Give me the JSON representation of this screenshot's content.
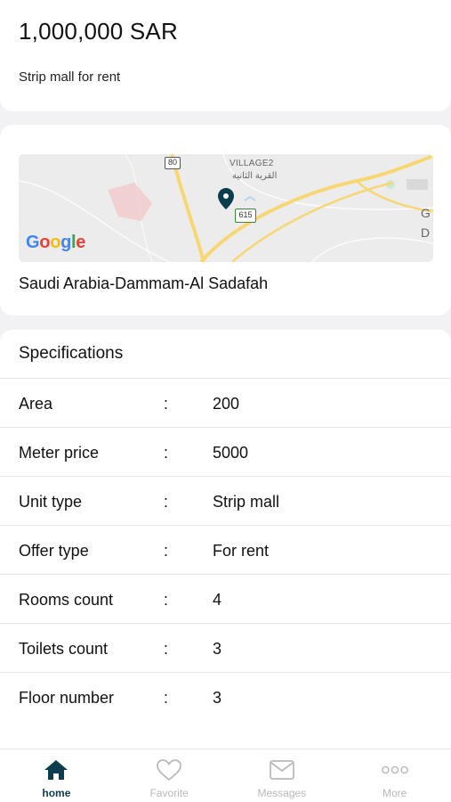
{
  "listing": {
    "price": "1,000,000 SAR",
    "subtitle": "Strip mall for rent",
    "address": "Saudi Arabia-Dammam-Al Sadafah"
  },
  "map": {
    "road_badge_1": "80",
    "road_badge_2": "615",
    "place_label_en": "VILLAGE2",
    "place_label_ar": "القرية الثانية",
    "provider": "Google",
    "edge_letters": [
      "G",
      "D"
    ]
  },
  "specifications": {
    "title": "Specifications",
    "separator": ":",
    "rows": [
      {
        "label": "Area",
        "value": "200"
      },
      {
        "label": "Meter price",
        "value": "5000"
      },
      {
        "label": "Unit type",
        "value": "Strip mall"
      },
      {
        "label": "Offer type",
        "value": "For rent"
      },
      {
        "label": "Rooms count",
        "value": "4"
      },
      {
        "label": "Toilets count",
        "value": "3"
      },
      {
        "label": "Floor number",
        "value": "3"
      }
    ]
  },
  "tabbar": {
    "tabs": [
      {
        "label": "home",
        "icon": "home-icon",
        "active": true
      },
      {
        "label": "Favorite",
        "icon": "heart-icon",
        "active": false
      },
      {
        "label": "Messages",
        "icon": "envelope-icon",
        "active": false
      },
      {
        "label": "More",
        "icon": "more-dots-icon",
        "active": false
      }
    ]
  },
  "colors": {
    "accent": "#0b3d4f",
    "inactive": "#b9b9b9",
    "background": "#f2f2f4"
  }
}
